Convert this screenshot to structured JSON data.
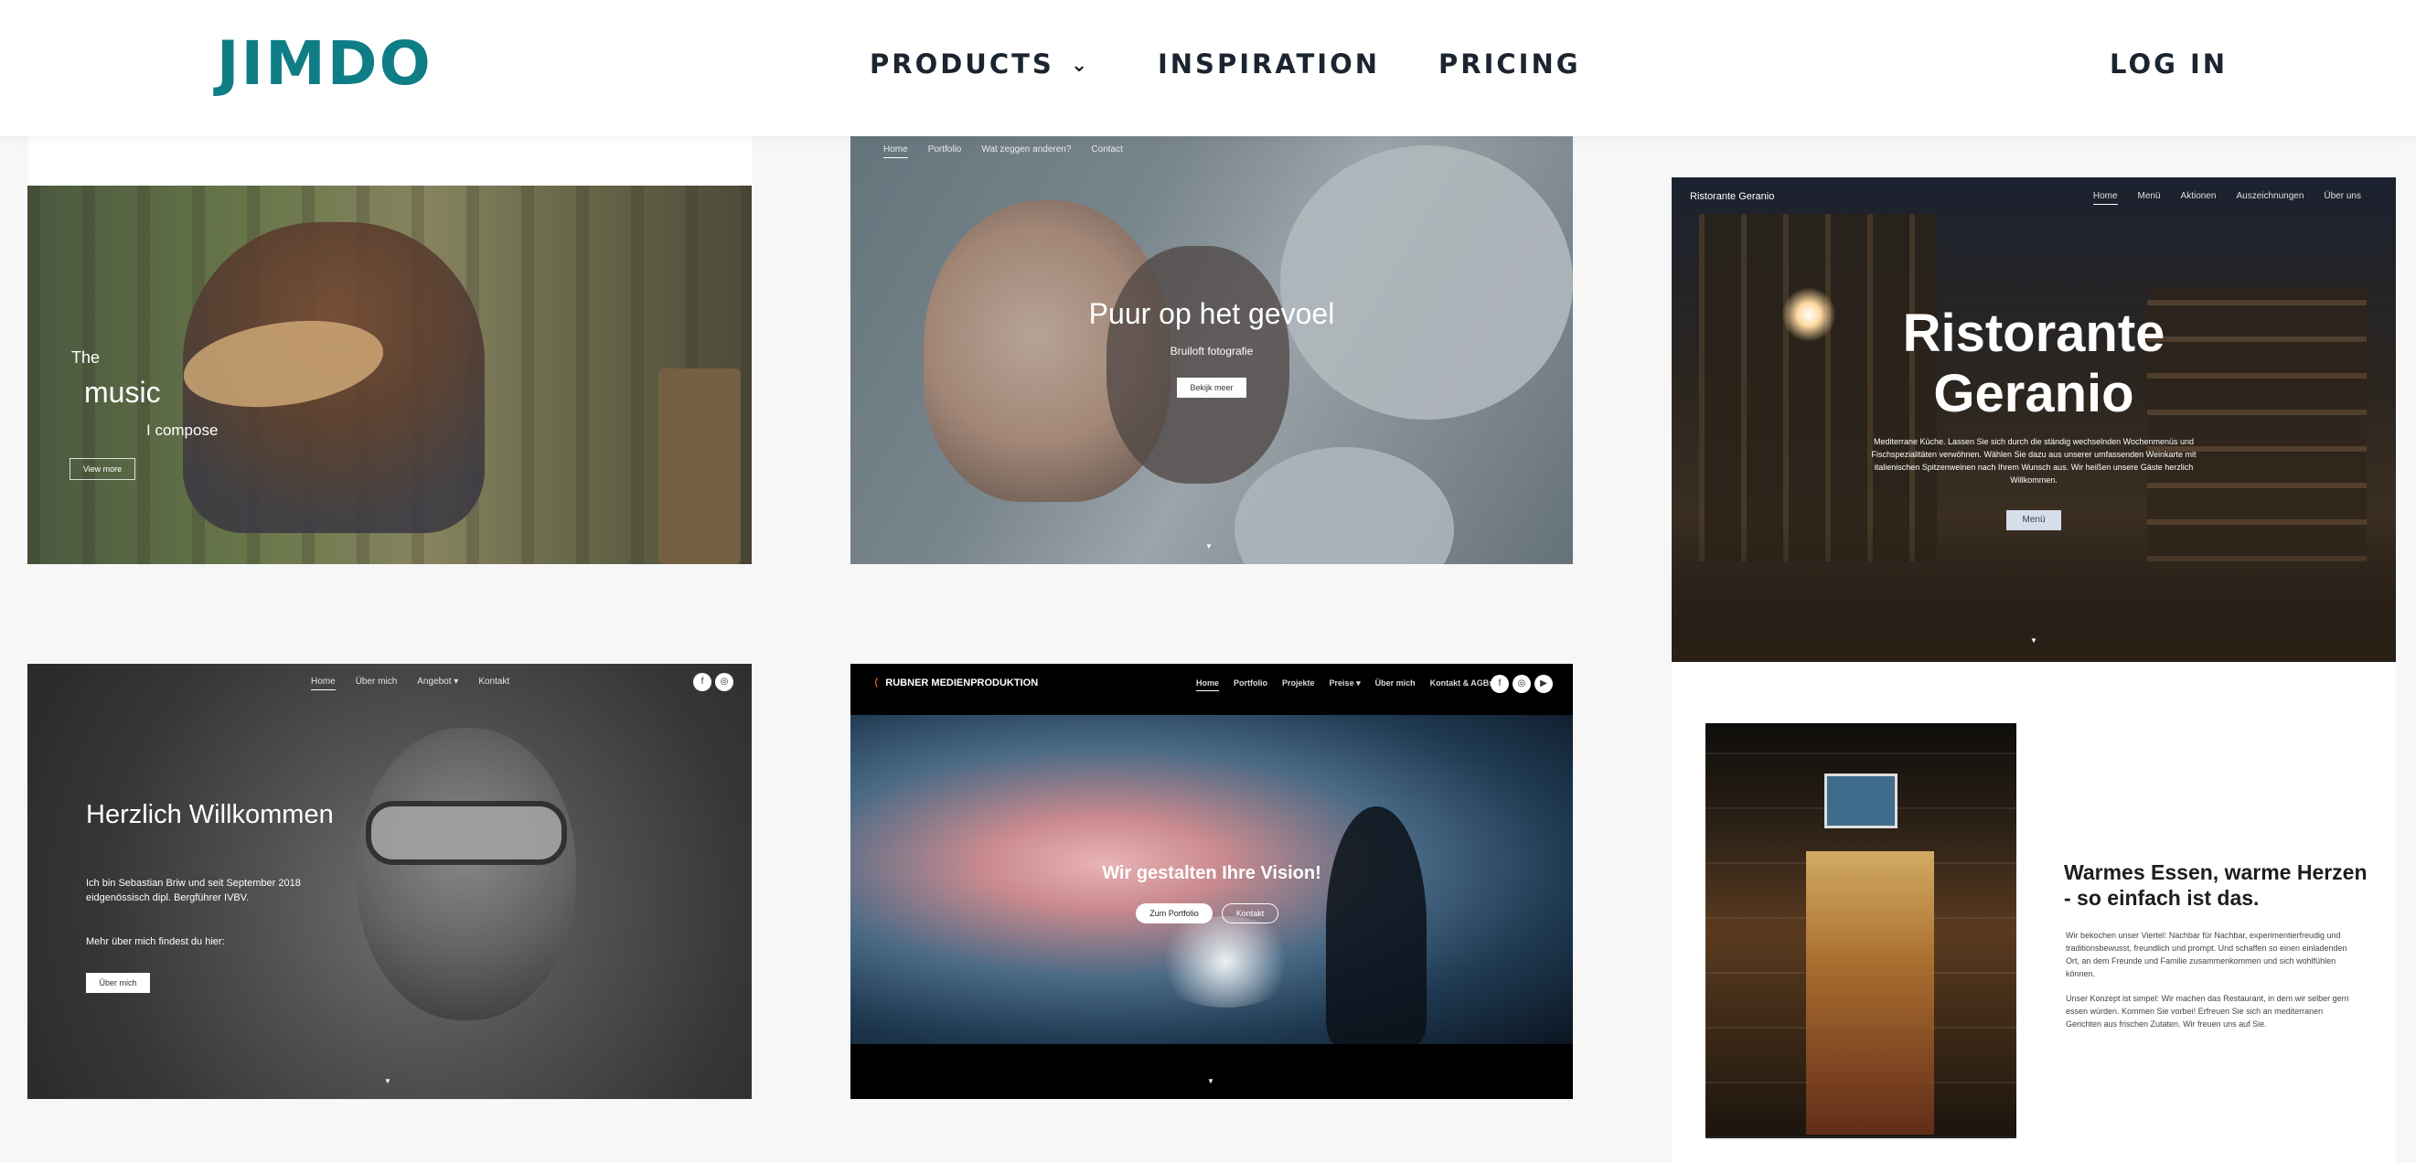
{
  "header": {
    "logo": "JIMDO",
    "nav": {
      "products": "PRODUCTS",
      "inspiration": "INSPIRATION",
      "pricing": "PRICING",
      "login": "LOG IN"
    },
    "accent_color": "#0e7d86"
  },
  "cards": {
    "music": {
      "line1": "The",
      "line2": "music",
      "line3": "I  compose",
      "button": "View more"
    },
    "wedding": {
      "nav": [
        "Home",
        "Portfolio",
        "Wat zeggen anderen?",
        "Contact"
      ],
      "title": "Puur op het gevoel",
      "subtitle": "Bruiloft fotografie",
      "button": "Bekijk meer"
    },
    "ristorante": {
      "brand": "Ristorante Geranio",
      "nav": [
        "Home",
        "Menü",
        "Aktionen",
        "Auszeichnungen",
        "Über uns"
      ],
      "title_line1": "Ristorante",
      "title_line2": "Geranio",
      "description": "Mediterrane Küche. Lassen Sie sich durch die ständig wechselnden Wochenmenüs und Fischspezialitäten verwöhnen. Wählen Sie dazu aus unserer umfassenden Weinkarte mit italienischen Spitzenweinen nach Ihrem Wunsch aus. Wir heißen unsere Gäste herzlich Willkommen.",
      "button": "Menü",
      "heading": "Warmes Essen, warme Herzen - so einfach ist das.",
      "para1": "Wir bekochen unser Viertel: Nachbar für Nachbar, experimentierfreudig und traditionsbewusst, freundlich und prompt. Und schaffen so einen einladenden Ort, an dem Freunde und Familie zusammenkommen und sich wohlfühlen können.",
      "para2": "Unser Konzept ist simpel: Wir machen das Restaurant, in dem wir selber gern essen würden. Kommen Sie vorbei! Erfreuen Sie sich an mediterranen Gerichten aus frischen Zutaten. Wir freuen uns auf Sie."
    },
    "willkommen": {
      "nav": [
        "Home",
        "Über mich",
        "Angebot ▾",
        "Kontakt"
      ],
      "title": "Herzlich Willkommen",
      "description": "Ich bin Sebastian Briw und seit September 2018 eidgenössisch dipl. Bergführer IVBV.",
      "more": "Mehr über mich findest du hier:",
      "button": "Über mich",
      "social": [
        "f",
        "◎"
      ]
    },
    "rubner": {
      "brand": "RUBNER MEDIENPRODUKTION",
      "nav": [
        "Home",
        "Portfolio",
        "Projekte",
        "Preise ▾",
        "Über mich",
        "Kontakt & AGBs"
      ],
      "title": "Wir gestalten Ihre Vision!",
      "button1": "Zum Portfolio",
      "button2": "Kontakt",
      "social": [
        "f",
        "◎",
        "▶"
      ]
    }
  }
}
